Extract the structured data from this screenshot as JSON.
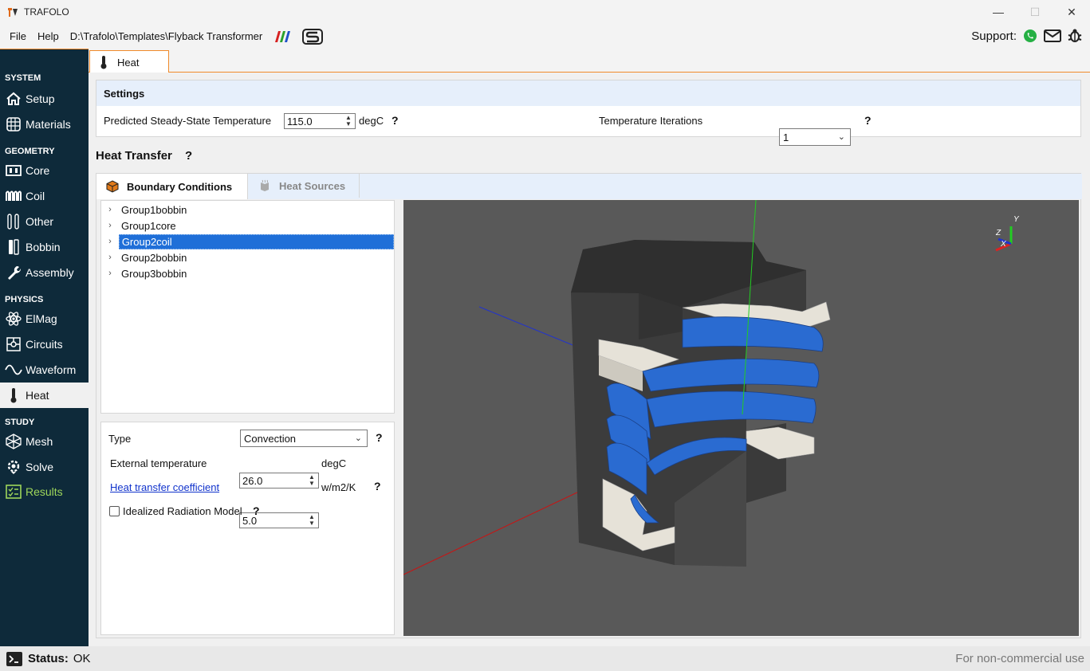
{
  "app": {
    "title": "TRAFOLO"
  },
  "window_controls": {
    "minimize": "—",
    "maximize": "☐",
    "close": "✕"
  },
  "menu": {
    "file": "File",
    "help": "Help",
    "project_path": "D:\\Trafolo\\Templates\\Flyback Transformer",
    "support_label": "Support:"
  },
  "sidebar": {
    "sections": [
      {
        "title": "SYSTEM",
        "items": [
          {
            "label": "Setup",
            "icon": "home-icon"
          },
          {
            "label": "Materials",
            "icon": "materials-icon"
          }
        ]
      },
      {
        "title": "GEOMETRY",
        "items": [
          {
            "label": "Core",
            "icon": "core-icon"
          },
          {
            "label": "Coil",
            "icon": "coil-icon"
          },
          {
            "label": "Other",
            "icon": "other-icon"
          },
          {
            "label": "Bobbin",
            "icon": "bobbin-icon"
          },
          {
            "label": "Assembly",
            "icon": "wrench-icon"
          }
        ]
      },
      {
        "title": "PHYSICS",
        "items": [
          {
            "label": "ElMag",
            "icon": "atom-icon"
          },
          {
            "label": "Circuits",
            "icon": "circuit-icon"
          },
          {
            "label": "Waveform",
            "icon": "wave-icon"
          },
          {
            "label": "Heat",
            "icon": "thermometer-icon"
          }
        ]
      },
      {
        "title": "STUDY",
        "items": [
          {
            "label": "Mesh",
            "icon": "mesh-icon"
          },
          {
            "label": "Solve",
            "icon": "solve-icon"
          },
          {
            "label": "Results",
            "icon": "results-icon"
          }
        ]
      }
    ],
    "active": "Heat"
  },
  "main_tab": {
    "label": "Heat"
  },
  "settings": {
    "header": "Settings",
    "predicted_temp_label": "Predicted Steady-State Temperature",
    "predicted_temp_value": "115.0",
    "predicted_temp_unit": "degC",
    "iterations_label": "Temperature Iterations",
    "iterations_value": "1",
    "help": "?"
  },
  "heat_transfer": {
    "title": "Heat Transfer",
    "help": "?",
    "tabs": [
      {
        "label": "Boundary Conditions"
      },
      {
        "label": "Heat Sources"
      }
    ],
    "tree": [
      {
        "label": "Group1bobbin",
        "selected": false
      },
      {
        "label": "Group1core",
        "selected": false
      },
      {
        "label": "Group2coil",
        "selected": true
      },
      {
        "label": "Group2bobbin",
        "selected": false
      },
      {
        "label": "Group3bobbin",
        "selected": false
      }
    ],
    "properties": {
      "type_label": "Type",
      "type_value": "Convection",
      "ext_temp_label": "External temperature",
      "ext_temp_value": "26.0",
      "ext_temp_unit": "degC",
      "htc_label": "Heat transfer coefficient",
      "htc_value": "5.0",
      "htc_unit": "w/m2/K",
      "radiation_label": "Idealized Radiation Model",
      "radiation_checked": false,
      "help": "?"
    },
    "viewport": {
      "axis_y": "Y",
      "axis_z": "Z",
      "axis_x": "X"
    }
  },
  "status": {
    "label": "Status:",
    "value": "OK",
    "license": "For non-commercial use"
  }
}
